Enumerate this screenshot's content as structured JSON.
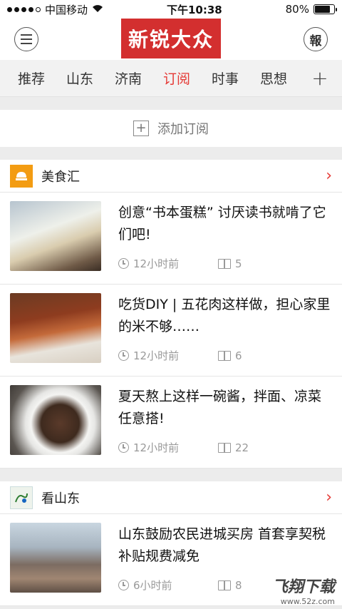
{
  "status_bar": {
    "carrier": "中国移动",
    "time": "下午10:38",
    "battery_text": "80%",
    "battery_level": 0.8
  },
  "header": {
    "logo_text": "新锐大众",
    "right_button_label": "報"
  },
  "tabs": {
    "items": [
      "推荐",
      "山东",
      "济南",
      "订阅",
      "时事",
      "思想"
    ],
    "active": "订阅",
    "add_label": "+"
  },
  "subscribe_bar": {
    "label": "添加订阅"
  },
  "sections": [
    {
      "title": "美食汇",
      "icon_text": "美食汇",
      "items": [
        {
          "title": "创意“书本蛋糕” 讨厌读书就啃了它们吧!",
          "time": "12小时前",
          "reads": "5"
        },
        {
          "title": "吃货DIY | 五花肉这样做，担心家里的米不够……",
          "time": "12小时前",
          "reads": "6"
        },
        {
          "title": "夏天熬上这样一碗酱，拌面、凉菜任意搭!",
          "time": "12小时前",
          "reads": "22"
        }
      ]
    },
    {
      "title": "看山东",
      "items": [
        {
          "title": "山东鼓励农民进城买房 首套享契税补贴规费减免",
          "time": "6小时前",
          "reads": "8"
        }
      ]
    }
  ],
  "watermark": {
    "main": "飞翔下载",
    "sub": "www.52z.com"
  }
}
